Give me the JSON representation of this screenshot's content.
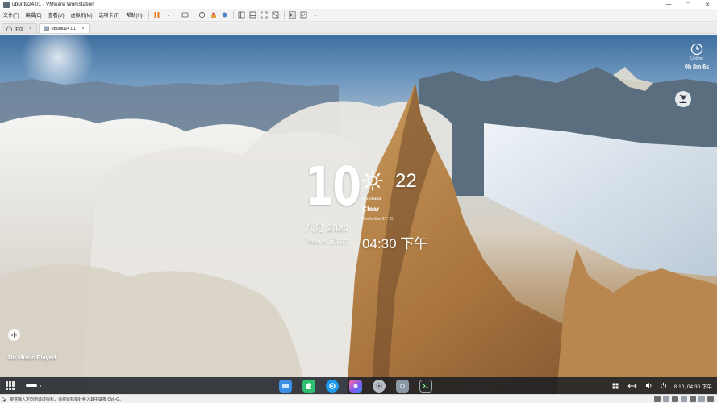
{
  "window": {
    "title": "ubuntu24.01 - VMware Workstation",
    "controls": {
      "minimize": "—",
      "maximize": "☐",
      "close": "✕"
    }
  },
  "menu": [
    "文件(F)",
    "编辑(E)",
    "查看(V)",
    "虚拟机(M)",
    "选项卡(T)",
    "帮助(H)"
  ],
  "tabs": [
    {
      "label": "主页",
      "active": false
    },
    {
      "label": "ubuntu24.01",
      "active": true
    }
  ],
  "desktop": {
    "uptime": {
      "label": "Uptime",
      "value": "0h 8m 6s"
    },
    "date": {
      "day": "10",
      "month_year": "八月 2024",
      "today": "Today's 星期六"
    },
    "weather": {
      "temp": "22",
      "location": "Australia",
      "condition": "Clear",
      "feels_like": "Feels like 21° C"
    },
    "time": "04:30 下午",
    "music": "No Music Played"
  },
  "taskbar": {
    "apps": [
      {
        "name": "files",
        "color": "#3a8ee6"
      },
      {
        "name": "extensions",
        "color": "#2fbf71"
      },
      {
        "name": "browser",
        "color": "#1d9bf0"
      },
      {
        "name": "media",
        "color": "#7a5cf0"
      },
      {
        "name": "settings",
        "color": "#9aa0a6"
      },
      {
        "name": "system",
        "color": "#8c98a6"
      },
      {
        "name": "terminal",
        "color": "#2b2b2b"
      }
    ],
    "clock": "8 10, 04:30 下午"
  },
  "statusbar": {
    "message": "要将输入定向到该虚拟机，请将鼠标指针移入其中或按 Ctrl+G。"
  }
}
